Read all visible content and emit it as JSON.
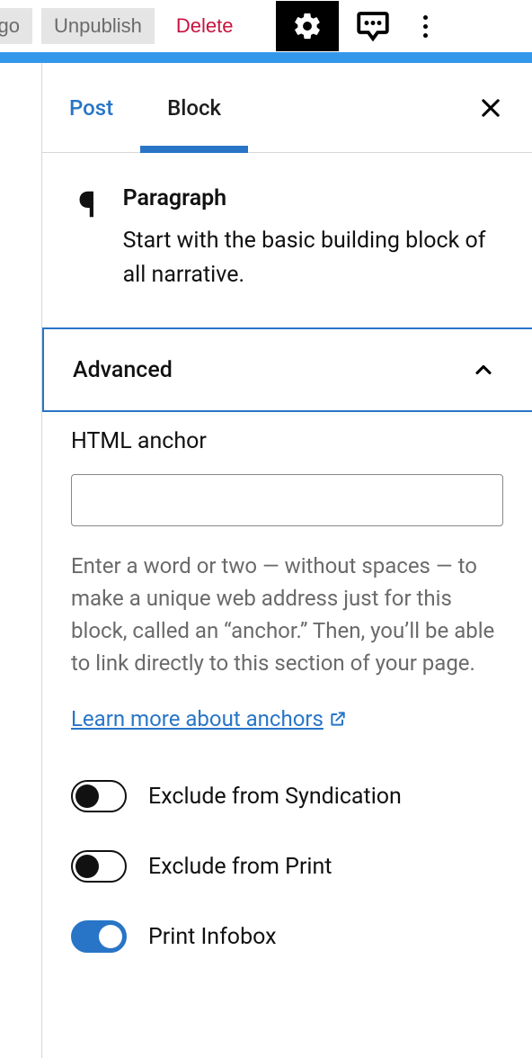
{
  "toolbar": {
    "embargo_label": "argo",
    "unpublish_label": "Unpublish",
    "delete_label": "Delete"
  },
  "tabs": {
    "post": "Post",
    "block": "Block"
  },
  "block_info": {
    "name": "Paragraph",
    "description": "Start with the basic building block of all narrative."
  },
  "accordion": {
    "title": "Advanced"
  },
  "anchor": {
    "label": "HTML anchor",
    "value": "",
    "help": "Enter a word or two — without spaces — to make a unique web address just for this block, called an “anchor.” Then, you’ll be able to link directly to this section of your page.",
    "link_text": "Learn more about anchors"
  },
  "toggles": {
    "exclude_syndication": {
      "label": "Exclude from Syndication",
      "on": false
    },
    "exclude_print": {
      "label": "Exclude from Print",
      "on": false
    },
    "print_infobox": {
      "label": "Print Infobox",
      "on": true
    }
  }
}
